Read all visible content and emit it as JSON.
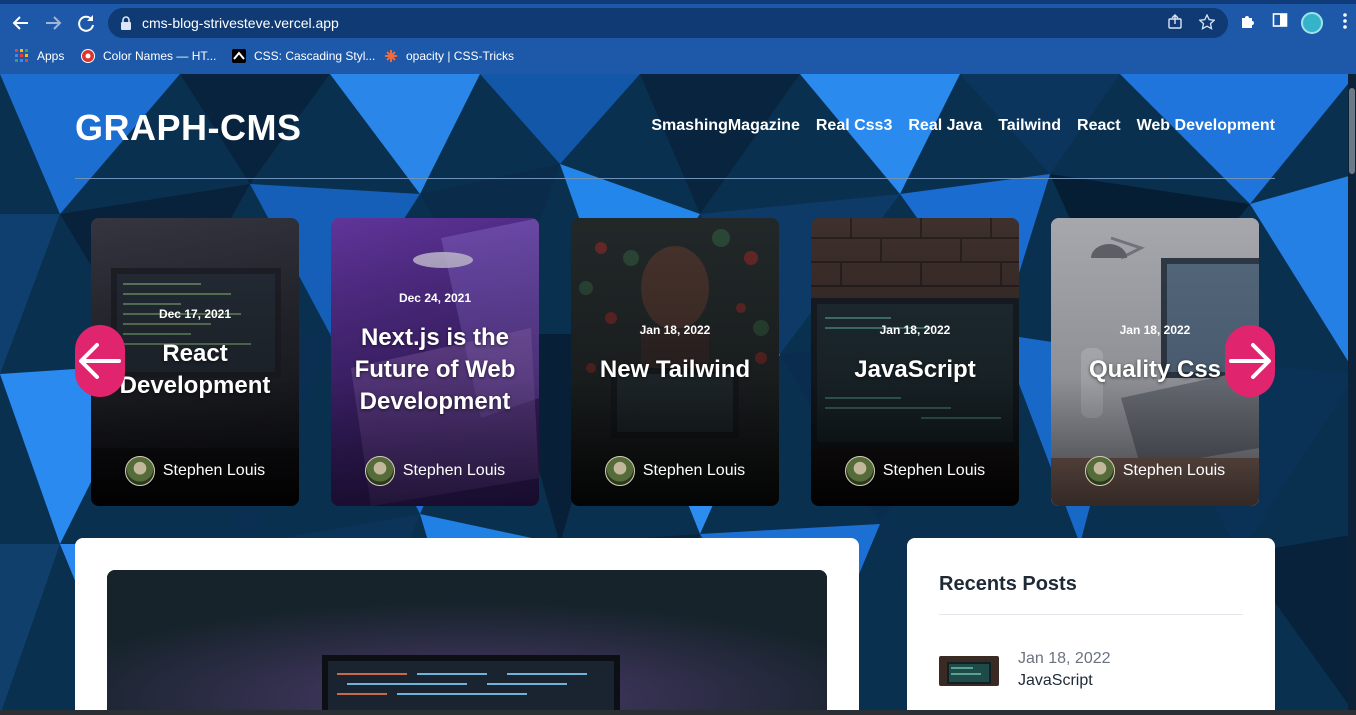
{
  "browser": {
    "url": "cms-blog-strivesteve.vercel.app",
    "bookmarks": [
      {
        "label": "Apps",
        "icon": "apps-grid-icon"
      },
      {
        "label": "Color Names — HT...",
        "icon": "color-names-icon"
      },
      {
        "label": "CSS: Cascading Styl...",
        "icon": "mdn-icon"
      },
      {
        "label": "opacity | CSS-Tricks",
        "icon": "css-tricks-icon"
      }
    ]
  },
  "site": {
    "title": "GRAPH-CMS",
    "nav": [
      "SmashingMagazine",
      "Real Css3",
      "Real Java",
      "Tailwind",
      "React",
      "Web Development"
    ]
  },
  "carousel": {
    "cards": [
      {
        "date": "Dec 17, 2021",
        "title": "React Development",
        "author": "Stephen Louis"
      },
      {
        "date": "Dec 24, 2021",
        "title": "Next.js is the Future of Web Development",
        "author": "Stephen Louis"
      },
      {
        "date": "Jan 18, 2022",
        "title": "New Tailwind",
        "author": "Stephen Louis"
      },
      {
        "date": "Jan 18, 2022",
        "title": "JavaScript",
        "author": "Stephen Louis"
      },
      {
        "date": "Jan 18, 2022",
        "title": "Quality Css",
        "author": "Stephen Louis"
      }
    ],
    "accent_color": "#e0246e"
  },
  "sidebar": {
    "title": "Recents Posts",
    "recent": [
      {
        "date": "Jan 18, 2022",
        "title": "JavaScript"
      }
    ]
  }
}
